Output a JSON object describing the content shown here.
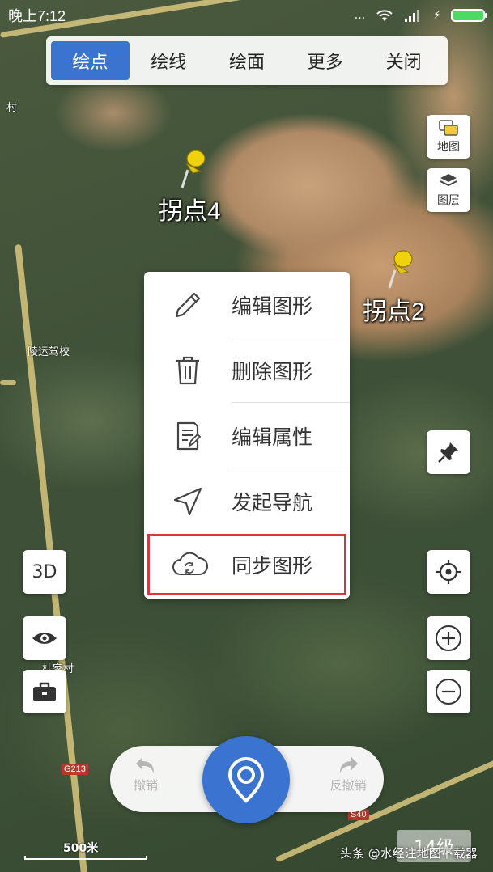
{
  "status_bar": {
    "time": "晚上7:12",
    "dots": "...",
    "charging": "⚡"
  },
  "toolbar": {
    "items": [
      {
        "label": "绘点",
        "active": true
      },
      {
        "label": "绘线",
        "active": false
      },
      {
        "label": "绘面",
        "active": false
      },
      {
        "label": "更多",
        "active": false
      },
      {
        "label": "关闭",
        "active": false
      }
    ]
  },
  "right_panel": {
    "map_label": "地图",
    "layer_label": "图层"
  },
  "pins": [
    {
      "label": "拐点4"
    },
    {
      "label": "拐点2"
    }
  ],
  "map_labels": {
    "place1": "陵运驾校",
    "place2": "村",
    "place3": "杜家村",
    "road1": "G213",
    "road2": "S40"
  },
  "context_menu": {
    "items": [
      {
        "label": "编辑图形",
        "icon": "pencil-icon"
      },
      {
        "label": "删除图形",
        "icon": "trash-icon"
      },
      {
        "label": "编辑属性",
        "icon": "properties-icon"
      },
      {
        "label": "发起导航",
        "icon": "navigation-arrow-icon"
      },
      {
        "label": "同步图形",
        "icon": "cloud-sync-icon",
        "highlighted": true
      }
    ]
  },
  "left_controls": {
    "three_d": "3D"
  },
  "bottom_bar": {
    "undo": "撤销",
    "redo": "反撤销"
  },
  "scale": "500米",
  "zoom_level": "14级",
  "watermark": "头条 @水经注地图下载器",
  "colors": {
    "accent": "#3a73d0",
    "highlight_border": "#d9363e"
  }
}
